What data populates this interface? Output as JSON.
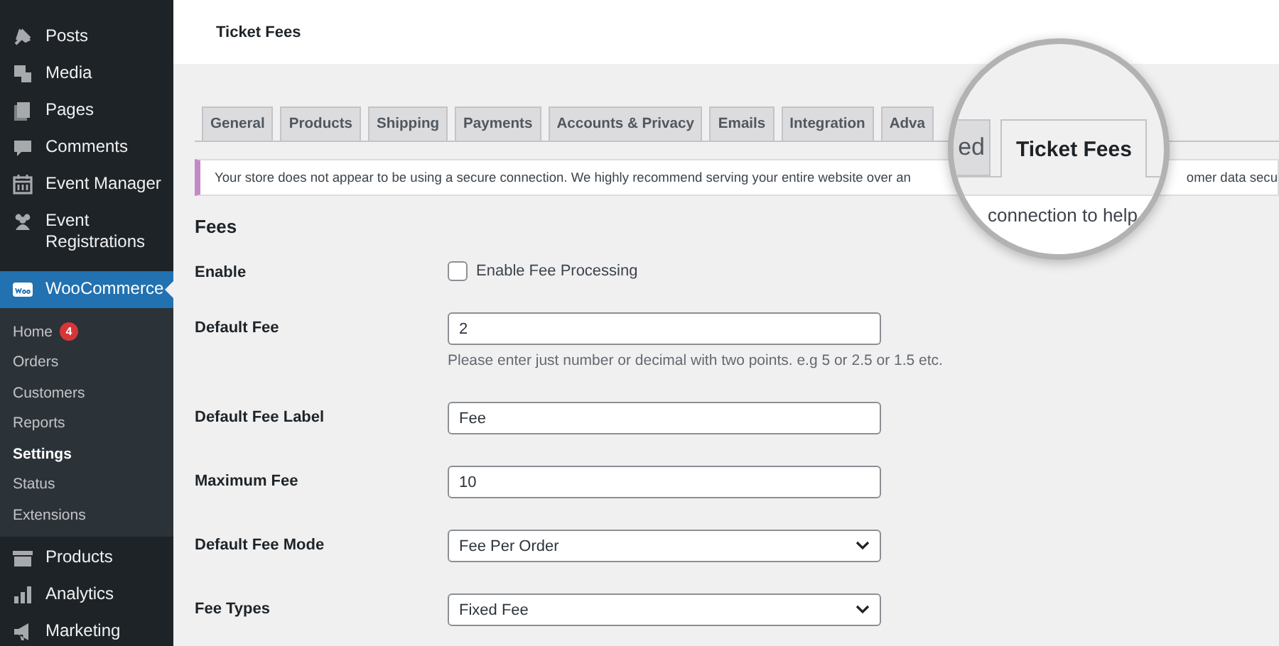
{
  "header": {
    "title": "Ticket Fees"
  },
  "sidebar": {
    "items": [
      {
        "label": "Posts",
        "selected": false
      },
      {
        "label": "Media",
        "selected": false
      },
      {
        "label": "Pages",
        "selected": false
      },
      {
        "label": "Comments",
        "selected": false
      },
      {
        "label": "Event Manager",
        "selected": false
      },
      {
        "label": "Event Registrations",
        "selected": false
      },
      {
        "label": "WooCommerce",
        "selected": true,
        "children": [
          {
            "label": "Home",
            "selected": false,
            "badge": "4"
          },
          {
            "label": "Orders",
            "selected": false
          },
          {
            "label": "Customers",
            "selected": false
          },
          {
            "label": "Reports",
            "selected": false
          },
          {
            "label": "Settings",
            "selected": true
          },
          {
            "label": "Status",
            "selected": false
          },
          {
            "label": "Extensions",
            "selected": false
          }
        ]
      },
      {
        "label": "Products",
        "selected": false
      },
      {
        "label": "Analytics",
        "selected": false
      },
      {
        "label": "Marketing",
        "selected": false
      }
    ]
  },
  "tabs": [
    {
      "label": "General",
      "selected": false
    },
    {
      "label": "Products",
      "selected": false
    },
    {
      "label": "Shipping",
      "selected": false
    },
    {
      "label": "Payments",
      "selected": false
    },
    {
      "label": "Accounts & Privacy",
      "selected": false
    },
    {
      "label": "Emails",
      "selected": false
    },
    {
      "label": "Integration",
      "selected": false
    },
    {
      "label": "Adva",
      "selected": false
    }
  ],
  "notice": {
    "text": "Your store does not appear to be using a secure connection. We highly recommend serving your entire website over an",
    "tail": "omer data secu"
  },
  "magnifier": {
    "partial_tab": "ed",
    "tab": {
      "label": "Ticket Fees",
      "selected": true
    },
    "notice_fragment": "connection to help"
  },
  "section": {
    "title": "Fees"
  },
  "fields": [
    {
      "kind": "checkbox",
      "label": "Enable",
      "option": "Enable Fee Processing",
      "checked": false
    },
    {
      "kind": "text",
      "label": "Default Fee",
      "value": "2",
      "hint": "Please enter just number or decimal with two points. e.g 5 or 2.5 or 1.5 etc."
    },
    {
      "kind": "text",
      "label": "Default Fee Label",
      "value": "Fee"
    },
    {
      "kind": "text",
      "label": "Maximum Fee",
      "value": "10"
    },
    {
      "kind": "select",
      "label": "Default Fee Mode",
      "value": "Fee Per Order"
    },
    {
      "kind": "select",
      "label": "Fee Types",
      "value": "Fixed Fee"
    }
  ]
}
